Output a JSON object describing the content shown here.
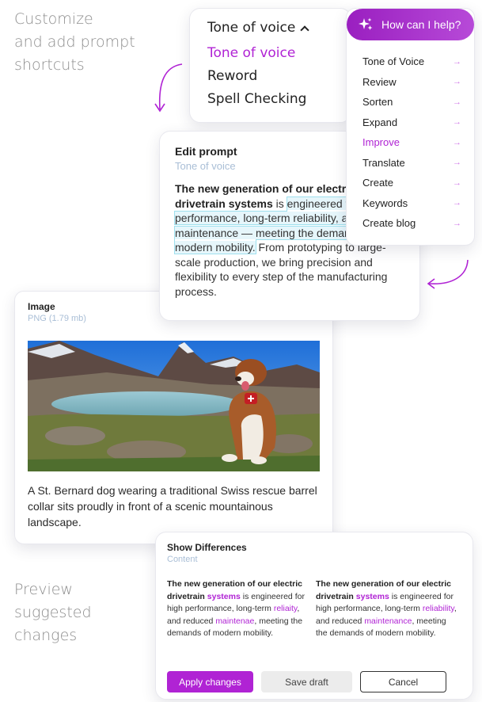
{
  "captions": {
    "top": [
      "Customize",
      "and add prompt",
      "shortcuts"
    ],
    "bottom": [
      "Preview",
      "suggested",
      "changes"
    ]
  },
  "tone_dropdown": {
    "selected": "Tone of voice",
    "options": [
      {
        "label": "Tone of voice",
        "active": true
      },
      {
        "label": "Reword",
        "active": false
      },
      {
        "label": "Spell Checking",
        "active": false
      }
    ]
  },
  "help_menu": {
    "button_label": "How can I help?",
    "items": [
      {
        "label": "Tone of Voice",
        "active": false
      },
      {
        "label": "Review",
        "active": false
      },
      {
        "label": "Sorten",
        "active": false
      },
      {
        "label": "Expand",
        "active": false
      },
      {
        "label": "Improve",
        "active": true
      },
      {
        "label": "Translate",
        "active": false
      },
      {
        "label": "Create",
        "active": false
      },
      {
        "label": "Keywords",
        "active": false
      },
      {
        "label": "Create blog",
        "active": false
      }
    ],
    "arrow": "→"
  },
  "edit_prompt": {
    "title": "Edit prompt",
    "subtitle": "Tone of voice",
    "bold": "The new generation of our electric drivetrain systems",
    "text_1": " is ",
    "highlight": "engineered for high performance, long-term reliability, and reduced maintenance — meeting the demands of modern mobility.",
    "text_2": " From prototyping to large-scale production, we bring precision and flexibility to every step of the manufacturing process."
  },
  "image_card": {
    "title": "Image",
    "subtitle": "PNG (1.79 mb)",
    "caption": "A St. Bernard dog wearing a traditional Swiss rescue barrel collar sits proudly in front of a scenic mountainous landscape."
  },
  "differences": {
    "title": "Show Differences",
    "subtitle": "Content",
    "original": {
      "bold_1": "The new generation of our electric drivetrain ",
      "bold_word": "systems",
      "text_1": " is engineered for high performance, long-term ",
      "word_1": "reliaity",
      "text_2": ", and reduced ",
      "word_2": "maintenae",
      "text_3": ", meeting the demands of modern mobility."
    },
    "suggested": {
      "bold_1": "The new generation of our electric drivetrain ",
      "bold_word": "systems",
      "text_1": " is engineered for high performance, long-term ",
      "word_1": "reliability",
      "text_2": ", and reduced ",
      "word_2": "maintenance",
      "text_3": ", meeting the demands of modern mobility."
    },
    "buttons": {
      "apply": "Apply changes",
      "draft": "Save draft",
      "cancel": "Cancel"
    }
  },
  "colors": {
    "accent": "#b023d4",
    "highlight_bg": "#e6f6fb",
    "highlight_border": "#9fe0ee",
    "muted": "#a9bed6"
  }
}
